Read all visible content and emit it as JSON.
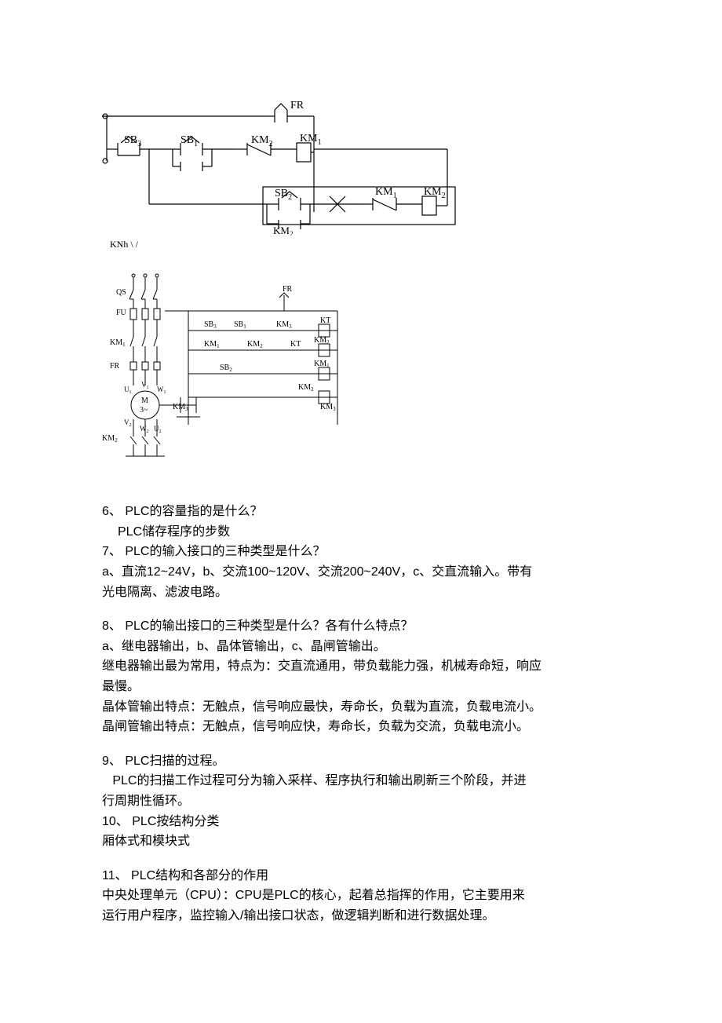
{
  "fig1_caption": "KNh \\ /",
  "q6_heading": "6、 PLC的容量指的是什么？",
  "q6_answer": "PLC储存程序的步数",
  "q7_heading": "7、 PLC的输入接口的三种类型是什么？",
  "q7_answer_line1": "a、直流12~24V，b、交流100~120V、交流200~240V，c、交直流输入。带有",
  "q7_answer_line2": "光电隔离、滤波电路。",
  "q8_heading": "8、 PLC的输出接口的三种类型是什么？各有什么特点？",
  "q8_line1": "a、继电器输出，b、晶体管输出，c、晶闸管输出。",
  "q8_line2": "继电器输出最为常用，特点为：交直流通用，带负载能力强，机械寿命短，响应",
  "q8_line3": "最慢。",
  "q8_line4": "晶体管输出特点：无触点，信号响应最快，寿命长，负载为直流，负载电流小。",
  "q8_line5": "晶闸管输出特点：无触点，信号响应快，寿命长，负载为交流，负载电流小。",
  "q9_heading": "9、 PLC扫描的过程。",
  "q9_line1": "   PLC的扫描工作过程可分为输入采样、程序执行和输出刷新三个阶段，并进",
  "q9_line2": "行周期性循环。",
  "q10_heading": "10、    PLC按结构分类",
  "q10_line1": "厢体式和模块式",
  "q11_heading": "11、    PLC结构和各部分的作用",
  "q11_line1": "中央处理单元（CPU）：CPU是PLC的核心，起着总指挥的作用，它主要用来",
  "q11_line2": "运行用户程序，监控输入/输出接口状态，做逻辑判断和进行数据处理。",
  "diagram1_labels": {
    "FR": "FR",
    "SB3": "SB",
    "SB3_sub": "3",
    "SB1": "SB",
    "SB1_sub": "1",
    "KM2": "KM",
    "KM2_sub": "2",
    "KM1": "KM",
    "KM1_sub": "1",
    "SB2": "SB",
    "SB2_sub": "2"
  },
  "diagram2_labels": {
    "QS": "QS",
    "FU": "FU",
    "FR": "FR",
    "SB3": "SB",
    "SB3_sub": "3",
    "SB1": "SB",
    "SB1_sub": "1",
    "SB2": "SB",
    "SB2_sub": "2",
    "KM1": "KM",
    "KM1_sub": "1",
    "KM2": "KM",
    "KM2_sub": "2",
    "KM3": "KM",
    "KM3_sub": "3",
    "KT": "KT",
    "M": "M",
    "M3": "3~",
    "U1": "U",
    "U1_sub": "1",
    "V1": "V",
    "V1_sub": "1",
    "W1": "W",
    "W1_sub": "1",
    "U2": "U",
    "U2_sub": "2",
    "V2": "V",
    "V2_sub": "2",
    "W2": "W",
    "W2_sub": "2"
  }
}
